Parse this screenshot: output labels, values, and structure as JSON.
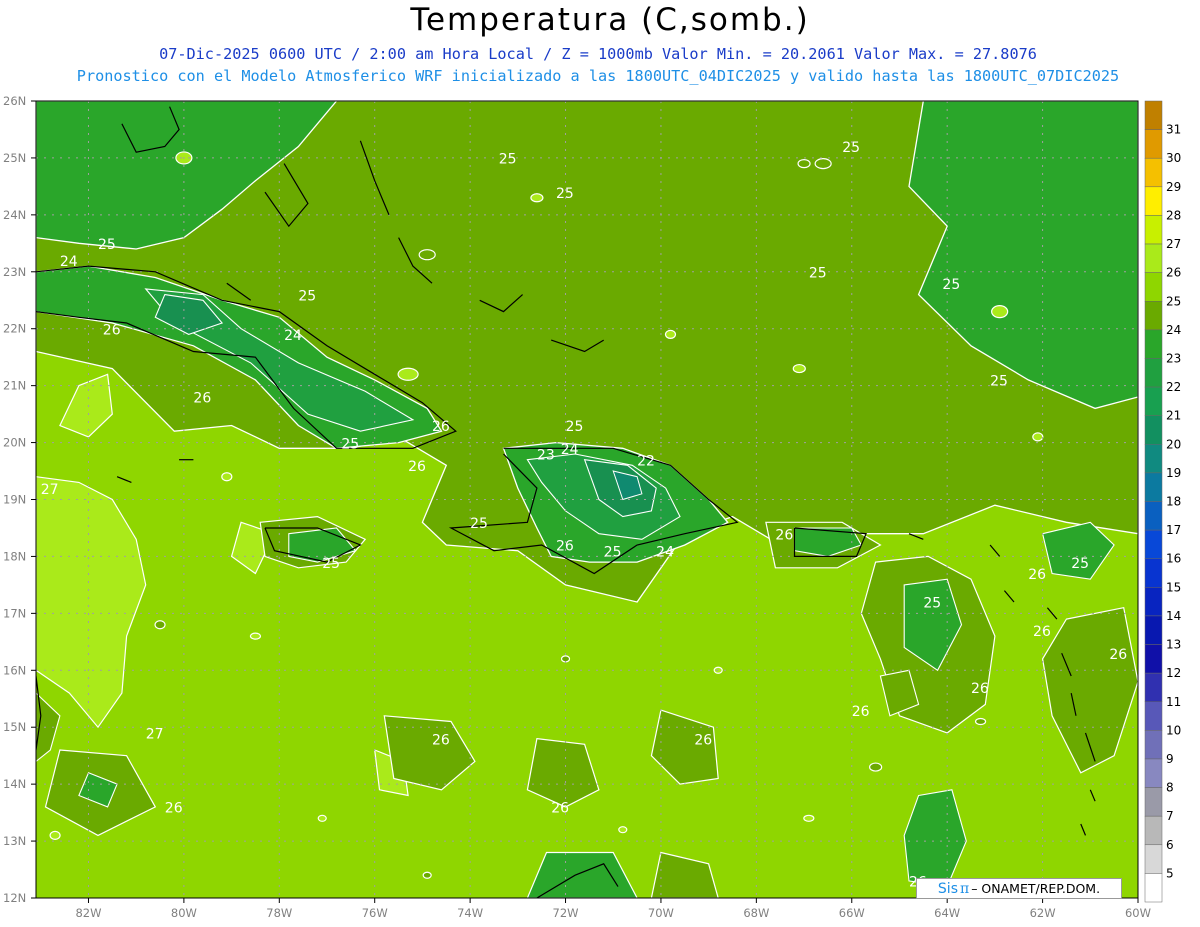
{
  "header": {
    "title": "Temperatura (C,somb.)",
    "subtitle_line1": "07-Dic-2025  0600 UTC / 2:00 am Hora Local / Z = 1000mb   Valor Min. = 20.2061  Valor Max. = 27.8076",
    "subtitle_line2": "Pronostico con el Modelo Atmosferico WRF inicializado a las 1800UTC_04DIC2025 y valido hasta las  1800UTC_07DIC2025"
  },
  "map": {
    "lat_range": [
      12,
      26
    ],
    "lon_range": [
      -83.1,
      -60
    ],
    "lat_labels": [
      "26N",
      "25N",
      "24N",
      "23N",
      "22N",
      "21N",
      "20N",
      "19N",
      "18N",
      "17N",
      "16N",
      "15N",
      "14N",
      "13N",
      "12N"
    ],
    "lon_labels": [
      "82W",
      "80W",
      "78W",
      "76W",
      "74W",
      "72W",
      "70W",
      "68W",
      "66W",
      "64W",
      "62W",
      "60W"
    ],
    "contour_labels": [
      {
        "text": "25",
        "lon": -73.4,
        "lat": 24.9
      },
      {
        "text": "25",
        "lon": -66.2,
        "lat": 25.1
      },
      {
        "text": "25",
        "lon": -72.2,
        "lat": 24.3
      },
      {
        "text": "25",
        "lon": -81.8,
        "lat": 23.4
      },
      {
        "text": "24",
        "lon": -82.6,
        "lat": 23.1
      },
      {
        "text": "25",
        "lon": -66.9,
        "lat": 22.9
      },
      {
        "text": "25",
        "lon": -64.1,
        "lat": 22.7
      },
      {
        "text": "25",
        "lon": -77.6,
        "lat": 22.5
      },
      {
        "text": "26",
        "lon": -81.7,
        "lat": 21.9
      },
      {
        "text": "24",
        "lon": -77.9,
        "lat": 21.8
      },
      {
        "text": "25",
        "lon": -63.1,
        "lat": 21.0
      },
      {
        "text": "26",
        "lon": -79.8,
        "lat": 20.7
      },
      {
        "text": "26",
        "lon": -74.8,
        "lat": 20.2
      },
      {
        "text": "25",
        "lon": -72.0,
        "lat": 20.2
      },
      {
        "text": "25",
        "lon": -76.7,
        "lat": 19.9
      },
      {
        "text": "24",
        "lon": -72.1,
        "lat": 19.8
      },
      {
        "text": "23",
        "lon": -72.6,
        "lat": 19.7
      },
      {
        "text": "22",
        "lon": -70.5,
        "lat": 19.6
      },
      {
        "text": "26",
        "lon": -75.3,
        "lat": 19.5
      },
      {
        "text": "27",
        "lon": -83.0,
        "lat": 19.1
      },
      {
        "text": "25",
        "lon": -74.0,
        "lat": 18.5
      },
      {
        "text": "26",
        "lon": -67.6,
        "lat": 18.3
      },
      {
        "text": "26",
        "lon": -72.2,
        "lat": 18.1
      },
      {
        "text": "25",
        "lon": -71.2,
        "lat": 18.0
      },
      {
        "text": "24",
        "lon": -70.1,
        "lat": 18.0
      },
      {
        "text": "25",
        "lon": -61.4,
        "lat": 17.8
      },
      {
        "text": "25",
        "lon": -77.1,
        "lat": 17.8
      },
      {
        "text": "26",
        "lon": -62.3,
        "lat": 17.6
      },
      {
        "text": "25",
        "lon": -64.5,
        "lat": 17.1
      },
      {
        "text": "26",
        "lon": -62.2,
        "lat": 16.6
      },
      {
        "text": "26",
        "lon": -60.6,
        "lat": 16.2
      },
      {
        "text": "26",
        "lon": -63.5,
        "lat": 15.6
      },
      {
        "text": "26",
        "lon": -66.0,
        "lat": 15.2
      },
      {
        "text": "27",
        "lon": -80.8,
        "lat": 14.8
      },
      {
        "text": "26",
        "lon": -74.8,
        "lat": 14.7
      },
      {
        "text": "26",
        "lon": -69.3,
        "lat": 14.7
      },
      {
        "text": "26",
        "lon": -80.4,
        "lat": 13.5
      },
      {
        "text": "26",
        "lon": -72.3,
        "lat": 13.5
      },
      {
        "text": "26",
        "lon": -64.8,
        "lat": 12.2
      }
    ]
  },
  "colorbar": {
    "labels": [
      "31",
      "30",
      "29",
      "28",
      "27",
      "26",
      "25",
      "24",
      "23",
      "22",
      "21",
      "20",
      "19",
      "18",
      "17",
      "16",
      "15",
      "14",
      "13",
      "12",
      "11",
      "10",
      "9",
      "8",
      "7",
      "6",
      "5"
    ],
    "colors": [
      "#c08000",
      "#e09a00",
      "#f5c000",
      "#ffee00",
      "#c8f000",
      "#aaea1a",
      "#8fd600",
      "#6aaa00",
      "#2aa62a",
      "#20a040",
      "#18a050",
      "#129060",
      "#108a80",
      "#0c7aa0",
      "#0a60c0",
      "#0848d8",
      "#0834d0",
      "#0824c0",
      "#0818b0",
      "#1010a8",
      "#3030b0",
      "#5858b8",
      "#7070b8",
      "#8888c0",
      "#9a9aa8",
      "#b8b8b8",
      "#d8d8d8",
      "#ffffff"
    ]
  },
  "credit": {
    "brand": "Sis",
    "symbol": "π",
    "text": "– ONAMET/REP.DOM."
  },
  "palette": {
    "t27": "#aaea1a",
    "t26": "#8fd600",
    "t25": "#6aaa00",
    "t24": "#2aa62a",
    "t23": "#20a040",
    "t22": "#189050",
    "t21": "#108a70",
    "coast": "#000000",
    "contour": "#ffffff",
    "grid": "#a0a0a0",
    "axis_text": "#808080"
  }
}
